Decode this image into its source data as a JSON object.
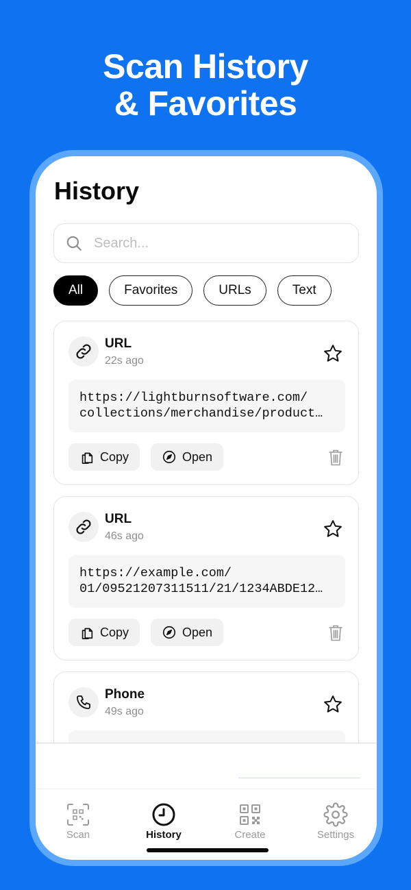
{
  "headline": {
    "line1": "Scan History",
    "line2": "& Favorites"
  },
  "screen": {
    "title": "History",
    "search": {
      "placeholder": "Search..."
    },
    "filters": [
      "All",
      "Favorites",
      "URLs",
      "Text"
    ],
    "active_filter": "All",
    "items": [
      {
        "type": "URL",
        "icon": "link-icon",
        "time": "22s ago",
        "content_lines": [
          "https://lightburnsoftware.com/",
          "collections/merchandise/product…"
        ],
        "favorite": false
      },
      {
        "type": "URL",
        "icon": "link-icon",
        "time": "46s ago",
        "content_lines": [
          "https://example.com/",
          "01/09521207311511/21/1234ABDE12…"
        ],
        "favorite": false
      },
      {
        "type": "Phone",
        "icon": "phone-icon",
        "time": "49s ago",
        "favorite": false
      }
    ],
    "actions": {
      "copy": "Copy",
      "open": "Open"
    },
    "tabs": [
      {
        "label": "Scan",
        "icon": "qr-scan-icon"
      },
      {
        "label": "History",
        "icon": "clock-icon"
      },
      {
        "label": "Create",
        "icon": "qr-code-icon"
      },
      {
        "label": "Settings",
        "icon": "gear-icon"
      }
    ],
    "active_tab": "History"
  }
}
